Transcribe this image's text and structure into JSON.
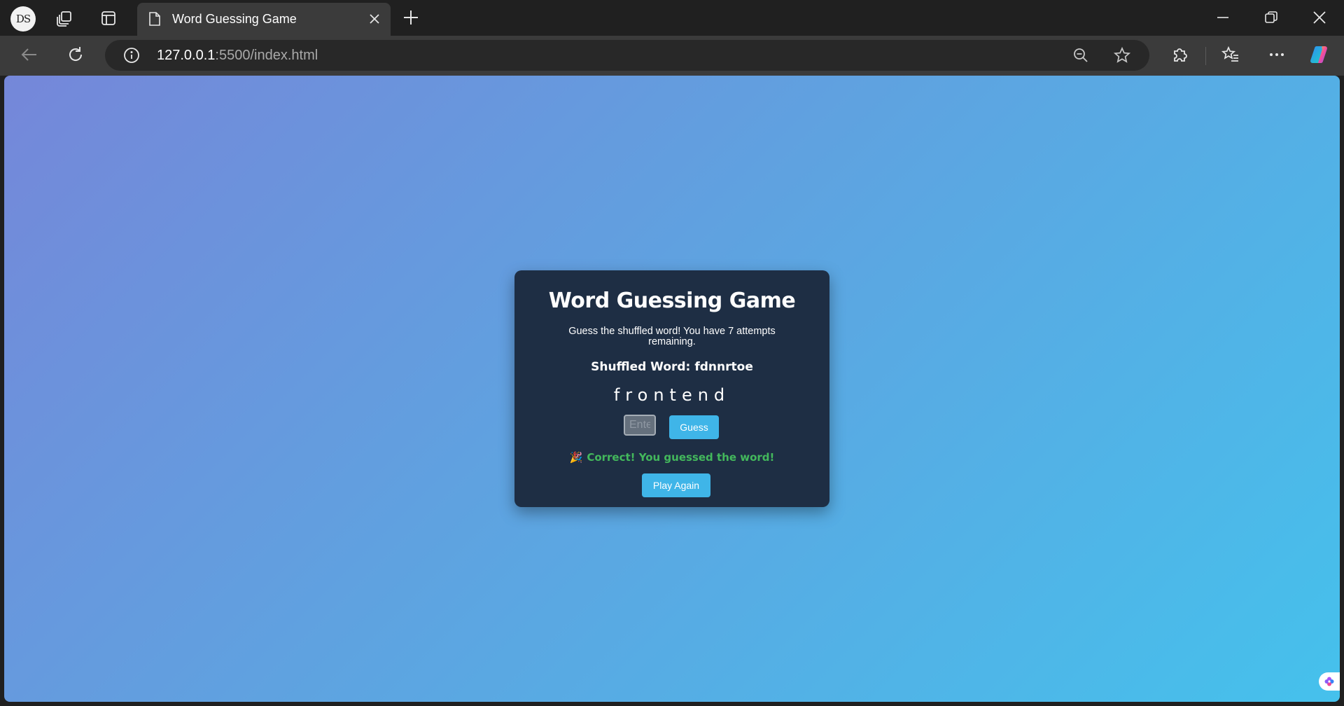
{
  "browser": {
    "profile_initials": "DS",
    "tab_title": "Word Guessing Game",
    "url_host": "127.0.0.1",
    "url_rest": ":5500/index.html"
  },
  "game": {
    "title": "Word Guessing Game",
    "instructions": "Guess the shuffled word! You have 7 attempts remaining.",
    "shuffled_label": "Shuffled Word:",
    "shuffled_word": "fdnnrtoe",
    "revealed_word": "frontend",
    "input_placeholder": "Enter",
    "guess_label": "Guess",
    "message_emoji": "🎉",
    "message": "Correct! You guessed the word!",
    "play_again_label": "Play Again"
  },
  "colors": {
    "card_bg": "#1e2e44",
    "button": "#3fb5e8",
    "success": "#43b85c"
  }
}
